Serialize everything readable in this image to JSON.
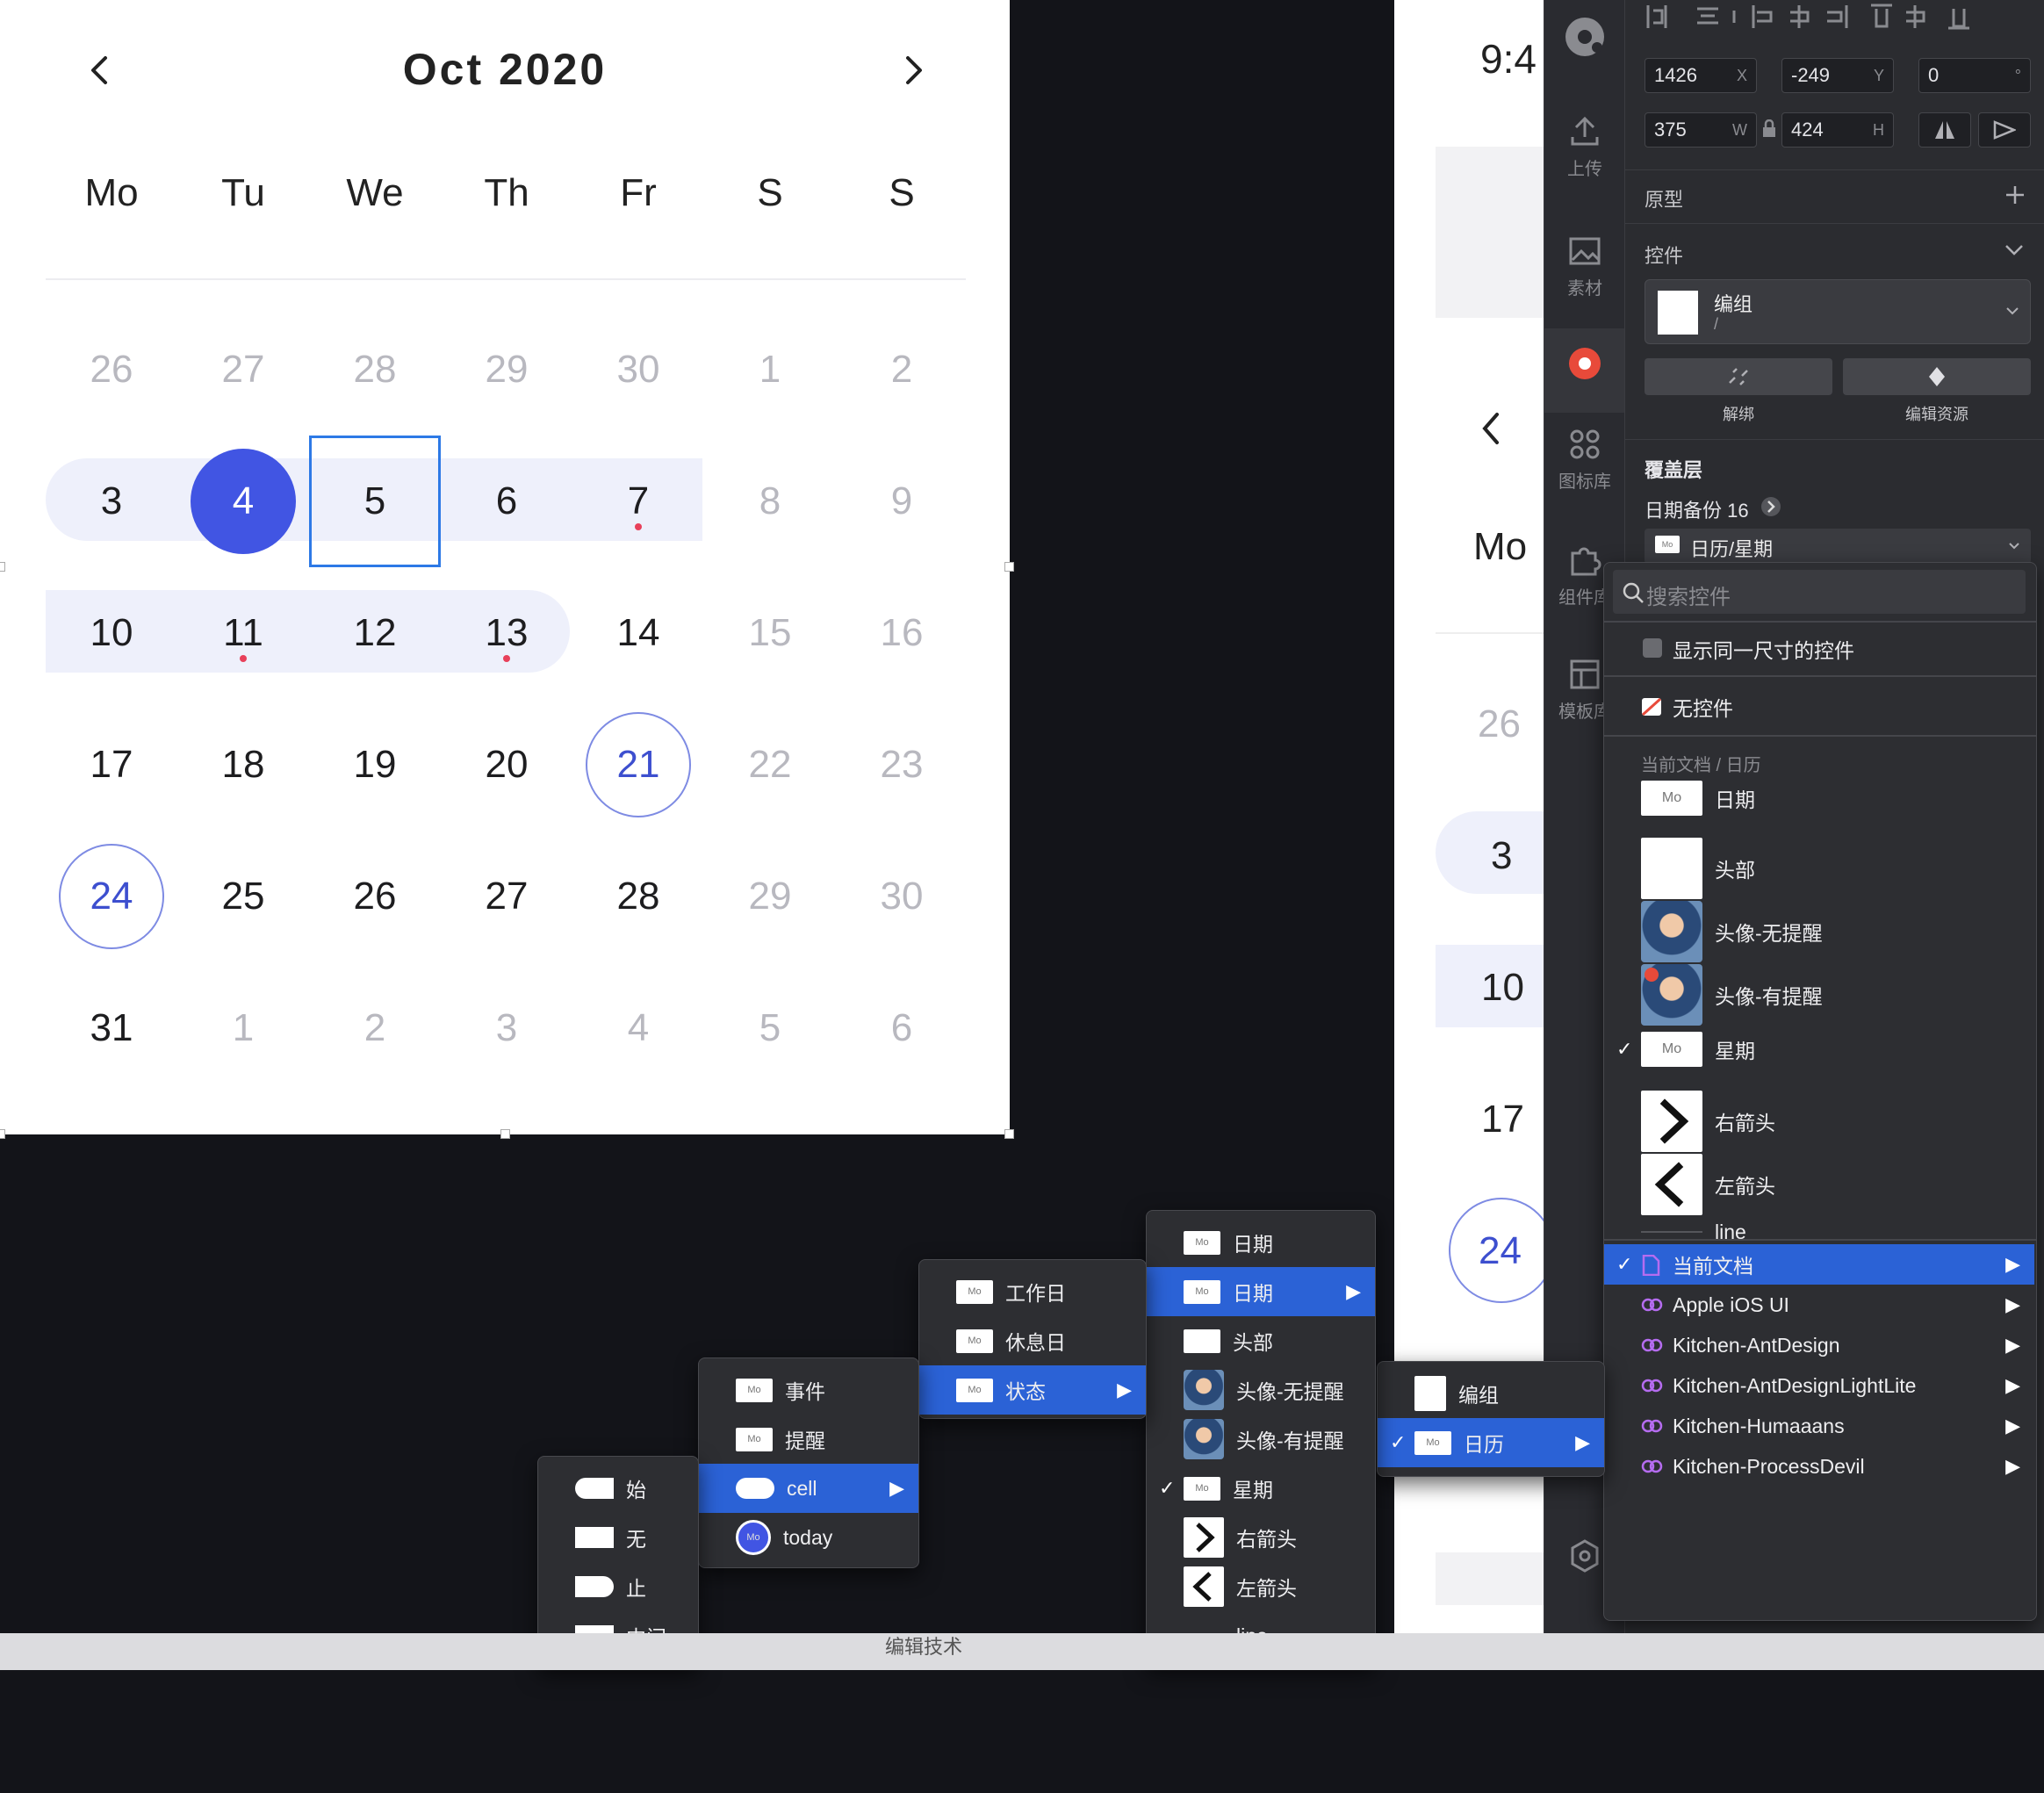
{
  "calendar": {
    "month_title": "Oct 2020",
    "weekdays": [
      "Mo",
      "Tu",
      "We",
      "Th",
      "Fr",
      "S",
      "S"
    ],
    "weeks": [
      [
        {
          "d": "26",
          "m": true
        },
        {
          "d": "27",
          "m": true
        },
        {
          "d": "28",
          "m": true
        },
        {
          "d": "29",
          "m": true
        },
        {
          "d": "30",
          "m": true
        },
        {
          "d": "1",
          "m": true
        },
        {
          "d": "2",
          "m": true
        }
      ],
      [
        {
          "d": "3"
        },
        {
          "d": "4",
          "sel": true
        },
        {
          "d": "5",
          "box": true
        },
        {
          "d": "6"
        },
        {
          "d": "7",
          "dot": true
        },
        {
          "d": "8",
          "m": true
        },
        {
          "d": "9",
          "m": true
        }
      ],
      [
        {
          "d": "10"
        },
        {
          "d": "11",
          "dot": true
        },
        {
          "d": "12"
        },
        {
          "d": "13",
          "dot": true
        },
        {
          "d": "14"
        },
        {
          "d": "15",
          "m": true
        },
        {
          "d": "16",
          "m": true
        }
      ],
      [
        {
          "d": "17"
        },
        {
          "d": "18"
        },
        {
          "d": "19"
        },
        {
          "d": "20"
        },
        {
          "d": "21",
          "ring": true
        },
        {
          "d": "22",
          "m": true
        },
        {
          "d": "23",
          "m": true
        }
      ],
      [
        {
          "d": "24",
          "ring": true
        },
        {
          "d": "25"
        },
        {
          "d": "26"
        },
        {
          "d": "27"
        },
        {
          "d": "28"
        },
        {
          "d": "29",
          "m": true
        },
        {
          "d": "30",
          "m": true
        }
      ],
      [
        {
          "d": "31"
        },
        {
          "d": "1",
          "m": true
        },
        {
          "d": "2",
          "m": true
        },
        {
          "d": "3",
          "m": true
        },
        {
          "d": "4",
          "m": true
        },
        {
          "d": "5",
          "m": true
        },
        {
          "d": "6",
          "m": true
        }
      ]
    ]
  },
  "phone": {
    "time": "9:4",
    "weekday": "Mo",
    "days": [
      "26",
      "3",
      "10",
      "17",
      "24"
    ]
  },
  "rail": {
    "items": [
      {
        "label": "上传",
        "icon": "upload-icon"
      },
      {
        "label": "素材",
        "icon": "image-icon"
      },
      {
        "label": "图标库",
        "icon": "grid-icon"
      },
      {
        "label": "组件库",
        "icon": "puzzle-icon"
      },
      {
        "label": "模板库",
        "icon": "template-icon"
      }
    ]
  },
  "inspector": {
    "x": "1426",
    "x_label": "X",
    "y": "-249",
    "y_label": "Y",
    "rotation": "0",
    "rotation_unit": "°",
    "w": "375",
    "w_label": "W",
    "h": "424",
    "h_label": "H",
    "prototype_label": "原型",
    "controls_label": "控件",
    "component_name": "编组",
    "component_path": "/",
    "unbind_label": "解绑",
    "edit_resource_label": "编辑资源",
    "overlay_label": "覆盖层",
    "overlay_item": "日期备份 16",
    "overlay_select": "日历/星期",
    "accent": "#2b62d6"
  },
  "dropdown": {
    "search_placeholder": "搜索控件",
    "show_same_size": "显示同一尺寸的控件",
    "no_control": "无控件",
    "section": "当前文档 / 日历",
    "items": [
      {
        "label": "日期",
        "thumb": "Mo"
      },
      {
        "label": "头部",
        "thumb": "-"
      },
      {
        "label": "头像-无提醒",
        "thumb": "avatar"
      },
      {
        "label": "头像-有提醒",
        "thumb": "avatar-dot"
      },
      {
        "label": "星期",
        "thumb": "Mo",
        "checked": true
      },
      {
        "label": "右箭头",
        "thumb": ">"
      },
      {
        "label": "左箭头",
        "thumb": "<"
      },
      {
        "label": "line",
        "thumb": "line"
      }
    ],
    "libraries": [
      {
        "label": "当前文档",
        "active": true
      },
      {
        "label": "Apple iOS UI"
      },
      {
        "label": "Kitchen-AntDesign"
      },
      {
        "label": "Kitchen-AntDesignLightLite"
      },
      {
        "label": "Kitchen-Humaaans"
      },
      {
        "label": "Kitchen-ProcessDevil"
      }
    ]
  },
  "menu_group": {
    "items": [
      {
        "label": "编组"
      },
      {
        "label": "日历",
        "thumb": "Mo",
        "checked": true
      }
    ]
  },
  "menu_calendar": {
    "items": [
      {
        "label": "日期",
        "thumb": "Mo"
      },
      {
        "label": "日期",
        "thumb": "Mo",
        "hl": true
      },
      {
        "label": "头部",
        "thumb": "-"
      },
      {
        "label": "头像-无提醒",
        "thumb": "avatar"
      },
      {
        "label": "头像-有提醒",
        "thumb": "avatar"
      },
      {
        "label": "星期",
        "thumb": "Mo",
        "checked": true
      },
      {
        "label": "右箭头",
        "thumb": ">"
      },
      {
        "label": "左箭头",
        "thumb": "<"
      },
      {
        "label": "line",
        "thumb": "line"
      }
    ]
  },
  "menu_date": {
    "items": [
      {
        "label": "工作日",
        "thumb": "Mo"
      },
      {
        "label": "休息日",
        "thumb": "Mo"
      },
      {
        "label": "状态",
        "thumb": "Mo",
        "hl": true
      }
    ]
  },
  "menu_state": {
    "items": [
      {
        "label": "事件",
        "thumb": "Mo"
      },
      {
        "label": "提醒",
        "thumb": "Mo"
      },
      {
        "label": "cell",
        "thumb": "pill",
        "hl": true
      },
      {
        "label": "today",
        "thumb": "Mo-blue"
      }
    ]
  },
  "menu_cell": {
    "items": [
      {
        "label": "始",
        "shape": "pillL"
      },
      {
        "label": "无",
        "shape": "rect"
      },
      {
        "label": "止",
        "shape": "pillR"
      },
      {
        "label": "中间",
        "shape": "rect"
      }
    ]
  },
  "bottom_strip": {
    "text": "编辑技术"
  }
}
